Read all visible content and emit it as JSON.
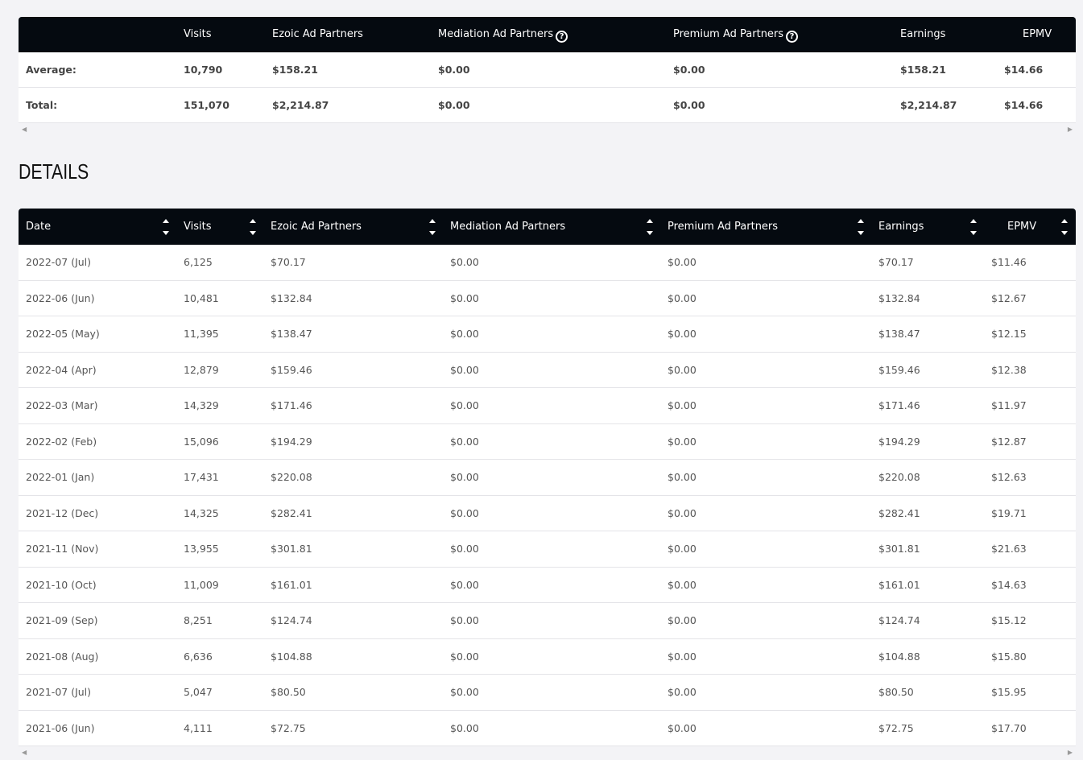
{
  "summary": {
    "columns": [
      "",
      "Visits",
      "Ezoic Ad Partners",
      "Mediation Ad Partners",
      "Premium Ad Partners",
      "Earnings",
      "EPMV"
    ],
    "rows": [
      {
        "label": "Average:",
        "visits": "10,790",
        "ezoic": "$158.21",
        "mediation": "$0.00",
        "premium": "$0.00",
        "earnings": "$158.21",
        "epmv": "$14.66"
      },
      {
        "label": "Total:",
        "visits": "151,070",
        "ezoic": "$2,214.87",
        "mediation": "$0.00",
        "premium": "$0.00",
        "earnings": "$2,214.87",
        "epmv": "$14.66"
      }
    ],
    "help_glyph": "?"
  },
  "details": {
    "title": "DETAILS",
    "columns": [
      "Date",
      "Visits",
      "Ezoic Ad Partners",
      "Mediation Ad Partners",
      "Premium Ad Partners",
      "Earnings",
      "EPMV"
    ],
    "rows": [
      {
        "date": "2022-07 (Jul)",
        "visits": "6,125",
        "ezoic": "$70.17",
        "mediation": "$0.00",
        "premium": "$0.00",
        "earnings": "$70.17",
        "epmv": "$11.46"
      },
      {
        "date": "2022-06 (Jun)",
        "visits": "10,481",
        "ezoic": "$132.84",
        "mediation": "$0.00",
        "premium": "$0.00",
        "earnings": "$132.84",
        "epmv": "$12.67"
      },
      {
        "date": "2022-05 (May)",
        "visits": "11,395",
        "ezoic": "$138.47",
        "mediation": "$0.00",
        "premium": "$0.00",
        "earnings": "$138.47",
        "epmv": "$12.15"
      },
      {
        "date": "2022-04 (Apr)",
        "visits": "12,879",
        "ezoic": "$159.46",
        "mediation": "$0.00",
        "premium": "$0.00",
        "earnings": "$159.46",
        "epmv": "$12.38"
      },
      {
        "date": "2022-03 (Mar)",
        "visits": "14,329",
        "ezoic": "$171.46",
        "mediation": "$0.00",
        "premium": "$0.00",
        "earnings": "$171.46",
        "epmv": "$11.97"
      },
      {
        "date": "2022-02 (Feb)",
        "visits": "15,096",
        "ezoic": "$194.29",
        "mediation": "$0.00",
        "premium": "$0.00",
        "earnings": "$194.29",
        "epmv": "$12.87"
      },
      {
        "date": "2022-01 (Jan)",
        "visits": "17,431",
        "ezoic": "$220.08",
        "mediation": "$0.00",
        "premium": "$0.00",
        "earnings": "$220.08",
        "epmv": "$12.63"
      },
      {
        "date": "2021-12 (Dec)",
        "visits": "14,325",
        "ezoic": "$282.41",
        "mediation": "$0.00",
        "premium": "$0.00",
        "earnings": "$282.41",
        "epmv": "$19.71"
      },
      {
        "date": "2021-11 (Nov)",
        "visits": "13,955",
        "ezoic": "$301.81",
        "mediation": "$0.00",
        "premium": "$0.00",
        "earnings": "$301.81",
        "epmv": "$21.63"
      },
      {
        "date": "2021-10 (Oct)",
        "visits": "11,009",
        "ezoic": "$161.01",
        "mediation": "$0.00",
        "premium": "$0.00",
        "earnings": "$161.01",
        "epmv": "$14.63"
      },
      {
        "date": "2021-09 (Sep)",
        "visits": "8,251",
        "ezoic": "$124.74",
        "mediation": "$0.00",
        "premium": "$0.00",
        "earnings": "$124.74",
        "epmv": "$15.12"
      },
      {
        "date": "2021-08 (Aug)",
        "visits": "6,636",
        "ezoic": "$104.88",
        "mediation": "$0.00",
        "premium": "$0.00",
        "earnings": "$104.88",
        "epmv": "$15.80"
      },
      {
        "date": "2021-07 (Jul)",
        "visits": "5,047",
        "ezoic": "$80.50",
        "mediation": "$0.00",
        "premium": "$0.00",
        "earnings": "$80.50",
        "epmv": "$15.95"
      },
      {
        "date": "2021-06 (Jun)",
        "visits": "4,111",
        "ezoic": "$72.75",
        "mediation": "$0.00",
        "premium": "$0.00",
        "earnings": "$72.75",
        "epmv": "$17.70"
      }
    ]
  },
  "scrollbar": {
    "left_arrow": "◀",
    "right_arrow": "▶"
  }
}
